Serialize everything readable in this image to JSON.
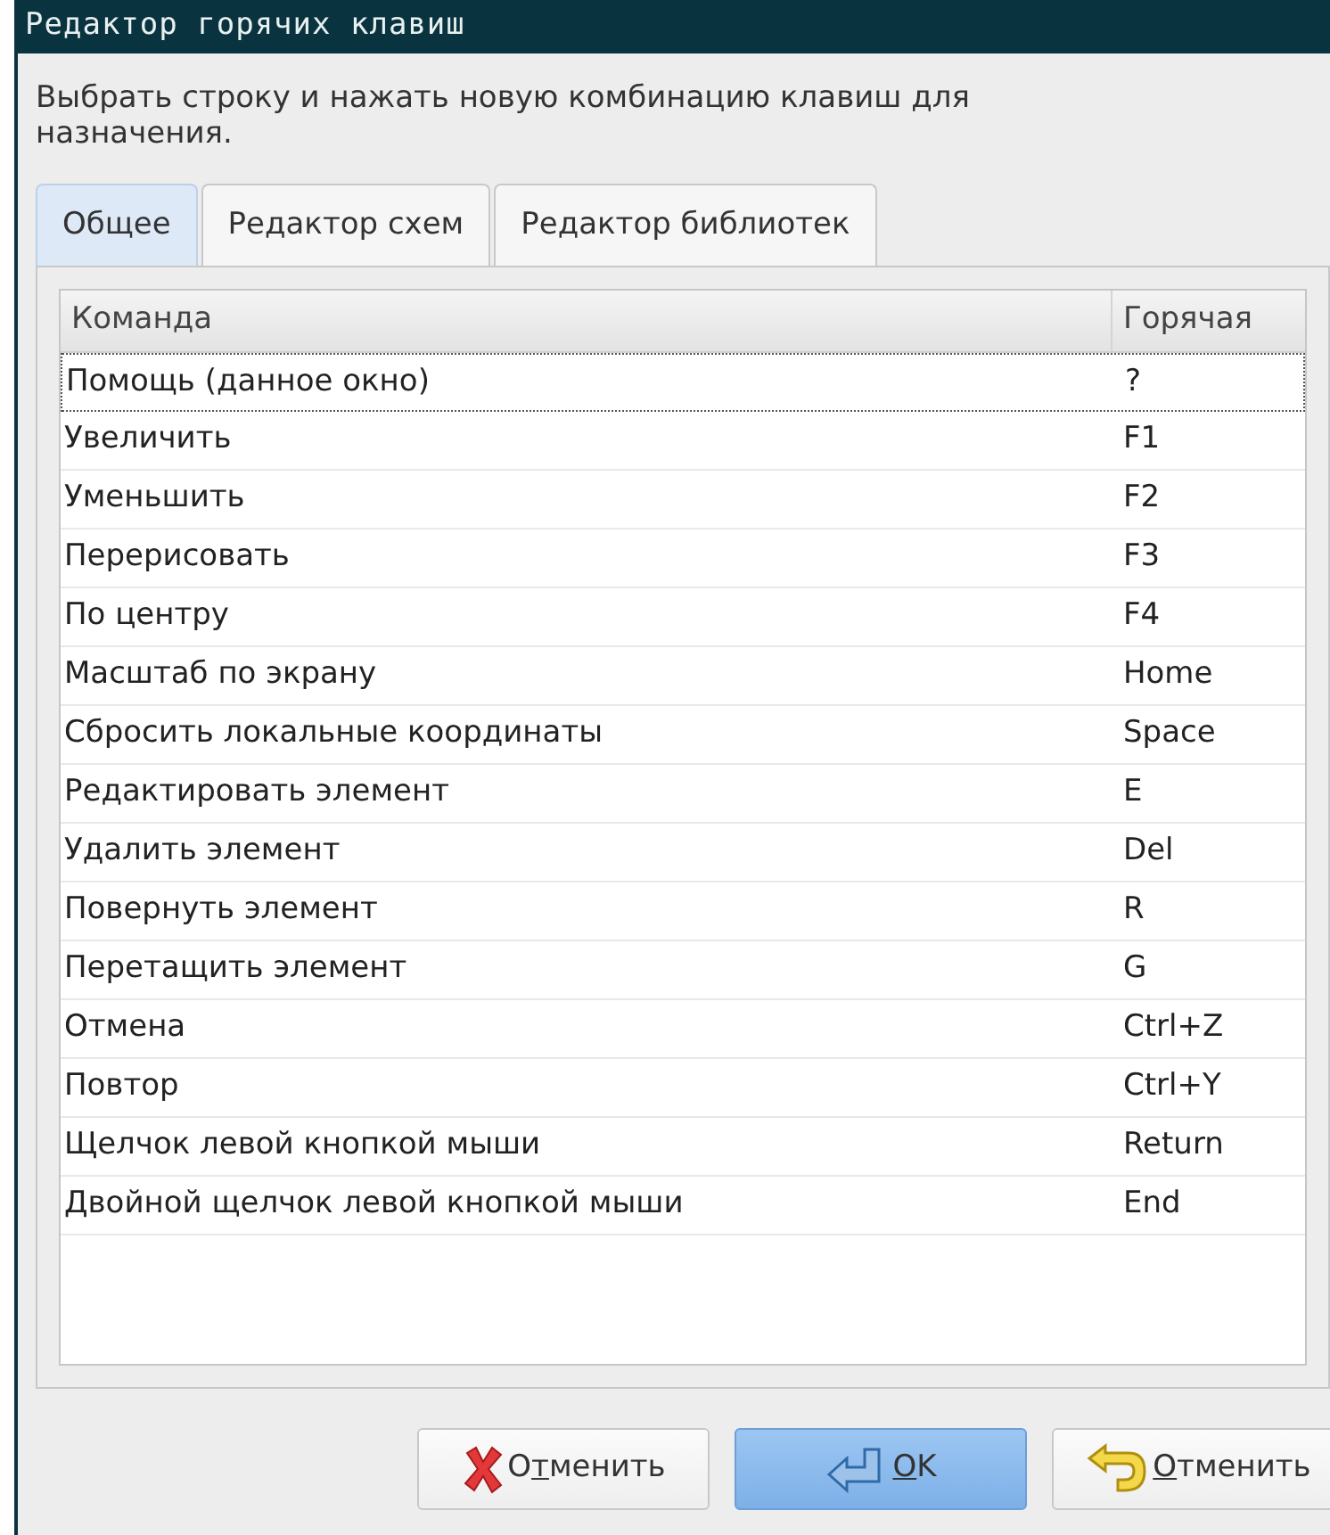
{
  "window": {
    "title": "Редактор горячих клавиш"
  },
  "instruction": "Выбрать строку и нажать новую комбинацию клавиш для назначения.",
  "tabs": [
    {
      "label": "Общее",
      "selected": true
    },
    {
      "label": "Редактор схем",
      "selected": false
    },
    {
      "label": "Редактор библиотек",
      "selected": false
    }
  ],
  "table": {
    "columns": [
      "Команда",
      "Горячая"
    ],
    "rows": [
      {
        "command": "Помощь (данное окно)",
        "key": "?",
        "focused": true
      },
      {
        "command": "Увеличить",
        "key": "F1",
        "focused": false
      },
      {
        "command": "Уменьшить",
        "key": "F2",
        "focused": false
      },
      {
        "command": "Перерисовать",
        "key": "F3",
        "focused": false
      },
      {
        "command": "По центру",
        "key": "F4",
        "focused": false
      },
      {
        "command": "Масштаб по экрану",
        "key": "Home",
        "focused": false
      },
      {
        "command": "Сбросить локальные координаты",
        "key": "Space",
        "focused": false
      },
      {
        "command": "Редактировать элемент",
        "key": "E",
        "focused": false
      },
      {
        "command": "Удалить элемент",
        "key": "Del",
        "focused": false
      },
      {
        "command": "Повернуть элемент",
        "key": "R",
        "focused": false
      },
      {
        "command": "Перетащить элемент",
        "key": "G",
        "focused": false
      },
      {
        "command": "Отмена",
        "key": "Ctrl+Z",
        "focused": false
      },
      {
        "command": "Повтор",
        "key": "Ctrl+Y",
        "focused": false
      },
      {
        "command": "Щелчок левой кнопкой мыши",
        "key": "Return",
        "focused": false
      },
      {
        "command": "Двойной щелчок левой кнопкой мыши",
        "key": "End",
        "focused": false
      }
    ]
  },
  "buttons": [
    {
      "kind": "cancel",
      "label_before": "О",
      "mnemonic": "т",
      "label_after": "менить",
      "default": false
    },
    {
      "kind": "ok",
      "mnemonic": "O",
      "label_after": "K",
      "default": true
    },
    {
      "kind": "revert",
      "mnemonic": "О",
      "label_after": "тменить",
      "default": false
    }
  ]
}
